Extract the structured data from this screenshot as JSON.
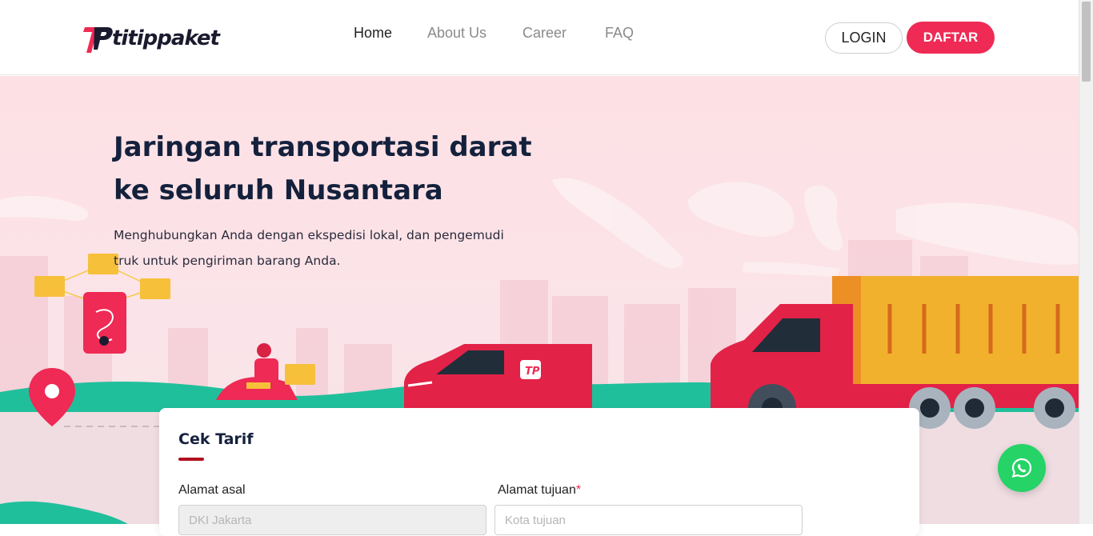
{
  "brand": {
    "name": "titippaket",
    "logo_mark": "TP-logo-icon"
  },
  "nav": {
    "links": [
      {
        "label": "Home",
        "active": true
      },
      {
        "label": "About Us",
        "active": false
      },
      {
        "label": "Career",
        "active": false
      },
      {
        "label": "FAQ",
        "active": false
      }
    ],
    "login_label": "LOGIN",
    "daftar_label": "DAFTAR"
  },
  "hero": {
    "title_line1": "Jaringan transportasi darat",
    "title_line2": "ke seluruh Nusantara",
    "subtitle_line1": "Menghubungkan Anda dengan ekspedisi lokal, dan pengemudi",
    "subtitle_line2": "truk untuk pengiriman barang Anda."
  },
  "cek_tarif": {
    "title": "Cek Tarif",
    "origin_label": "Alamat asal",
    "origin_placeholder": "DKI Jakarta",
    "destination_label": "Alamat tujuan",
    "destination_required": "*",
    "destination_placeholder": "Kota tujuan"
  },
  "colors": {
    "brand_red": "#ee2a55",
    "navy": "#14213d",
    "hero_bg": "#fde0e4",
    "whatsapp": "#25d366"
  },
  "icons": {
    "whatsapp": "whatsapp-icon",
    "map_pin": "map-pin-icon"
  }
}
